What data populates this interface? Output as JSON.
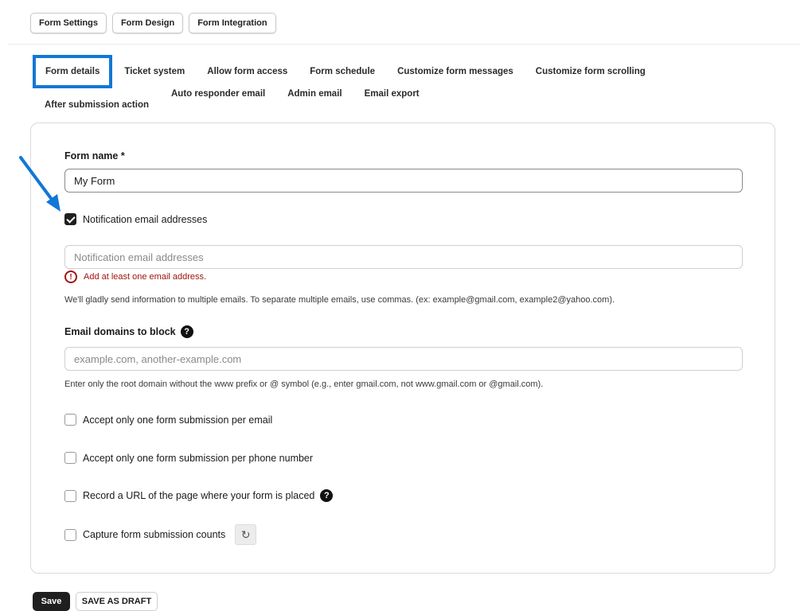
{
  "top_tabs": [
    "Form Settings",
    "Form Design",
    "Form Integration"
  ],
  "sub_tabs": {
    "row1": [
      "Form details",
      "Ticket system",
      "Allow form access",
      "Form schedule",
      "Customize form messages",
      "Customize form scrolling",
      "After submission action"
    ],
    "row2": [
      "Auto responder email",
      "Admin email",
      "Email export"
    ],
    "active": "Form details"
  },
  "form": {
    "name_label": "Form name *",
    "name_value": "My Form",
    "notify_checkbox_label": "Notification email addresses",
    "notify_checked": true,
    "notify_placeholder": "Notification email addresses",
    "error_icon": "!",
    "notify_error": "Add at least one email address.",
    "notify_help": "We'll gladly send information to multiple emails. To separate multiple emails, use commas. (ex: example@gmail.com, example2@yahoo.com).",
    "block_label": "Email domains to block",
    "block_placeholder": "example.com, another-example.com",
    "block_help": "Enter only the root domain without the www prefix or @ symbol (e.g., enter gmail.com, not www.gmail.com or @gmail.com).",
    "opt_one_per_email": "Accept only one form submission per email",
    "opt_one_per_phone": "Accept only one form submission per phone number",
    "opt_record_url": "Record a URL of the page where your form is placed",
    "opt_capture_counts": "Capture form submission counts"
  },
  "icons": {
    "help": "question-circle-icon",
    "refresh": "refresh-icon",
    "error": "alert-circle-icon",
    "arrow": "annotation-arrow-icon"
  },
  "colors": {
    "highlight": "#1277d6",
    "error": "#a11212",
    "primary_button": "#1f1f1f"
  },
  "actions": {
    "save": "Save",
    "save_draft": "SAVE AS DRAFT"
  }
}
